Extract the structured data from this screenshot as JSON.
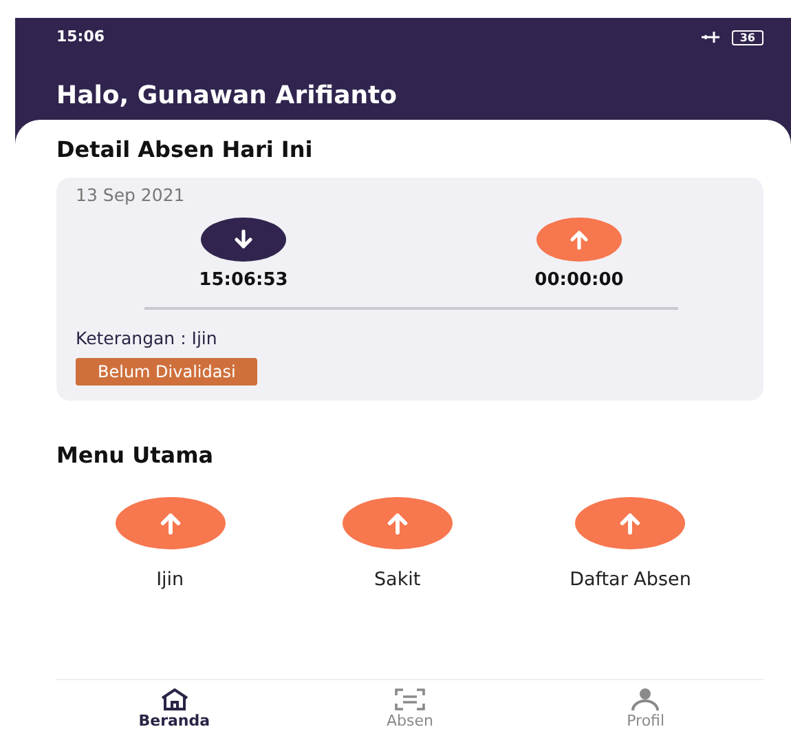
{
  "status_bar": {
    "time": "15:06",
    "battery": "36"
  },
  "header": {
    "greeting": "Halo, Gunawan Arifianto"
  },
  "detail": {
    "title": "Detail Absen Hari Ini",
    "date": "13 Sep 2021",
    "clocks": [
      {
        "kind": "in",
        "time": "15:06:53"
      },
      {
        "kind": "out",
        "time": "00:00:00"
      }
    ],
    "note": "Keterangan : Ijin",
    "status": "Belum Divalidasi"
  },
  "menu": {
    "title": "Menu Utama",
    "items": [
      {
        "label": "Ijin"
      },
      {
        "label": "Sakit"
      },
      {
        "label": "Daftar Absen"
      }
    ]
  },
  "bottom_nav": [
    {
      "kind": "home",
      "label": "Beranda",
      "selected": true
    },
    {
      "kind": "scan",
      "label": "Absen",
      "selected": false
    },
    {
      "kind": "profile",
      "label": "Profil",
      "selected": false
    }
  ]
}
